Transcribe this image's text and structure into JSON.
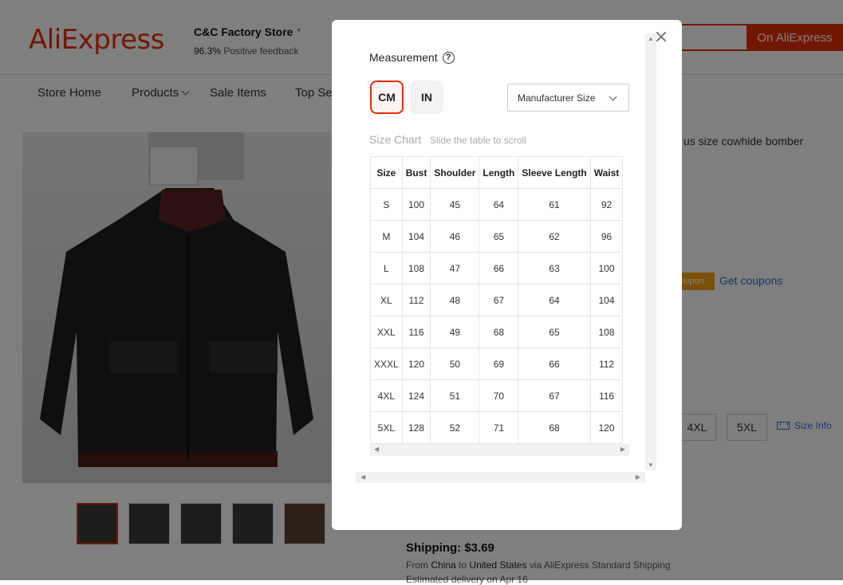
{
  "header": {
    "logo": "AliExpress",
    "store_name": "C&C Factory Store",
    "feedback_pct": "96.3%",
    "feedback_label": "Positive feedback",
    "search_button": "On AliExpress"
  },
  "nav": {
    "items": [
      "Store Home",
      "Products",
      "Sale Items",
      "Top Se"
    ]
  },
  "product": {
    "title_fragment": "us size cowhide bomber",
    "coupon_tag": "oupon",
    "get_coupons": "Get coupons",
    "sizes": [
      "4XL",
      "5XL"
    ],
    "size_info": "Size Info",
    "shipping": "Shipping: $3.69",
    "ship_from_prefix": "From",
    "ship_from": "China",
    "ship_to_prefix": "to",
    "ship_to": "United States",
    "ship_via": "via AliExpress Standard Shipping",
    "delivery": "Estimated delivery on Apr 16"
  },
  "modal": {
    "title": "Measurement",
    "help_icon": "?",
    "units": [
      "CM",
      "IN"
    ],
    "selected_unit": "CM",
    "size_type": "Manufacturer Size",
    "chart_label": "Size Chart",
    "chart_hint": "Slide the table to scroll",
    "columns": [
      "Size",
      "Bust",
      "Shoulder",
      "Length",
      "Sleeve Length",
      "Waist"
    ],
    "rows": [
      [
        "S",
        "100",
        "45",
        "64",
        "61",
        "92"
      ],
      [
        "M",
        "104",
        "46",
        "65",
        "62",
        "96"
      ],
      [
        "L",
        "108",
        "47",
        "66",
        "63",
        "100"
      ],
      [
        "XL",
        "112",
        "48",
        "67",
        "64",
        "104"
      ],
      [
        "XXL",
        "116",
        "49",
        "68",
        "65",
        "108"
      ],
      [
        "XXXL",
        "120",
        "50",
        "69",
        "66",
        "112"
      ],
      [
        "4XL",
        "124",
        "51",
        "70",
        "67",
        "116"
      ],
      [
        "5XL",
        "128",
        "52",
        "71",
        "68",
        "120"
      ]
    ]
  },
  "colors": {
    "accent": "#e62e04",
    "link": "#2e6fd9",
    "coupon": "#f7a10e"
  }
}
